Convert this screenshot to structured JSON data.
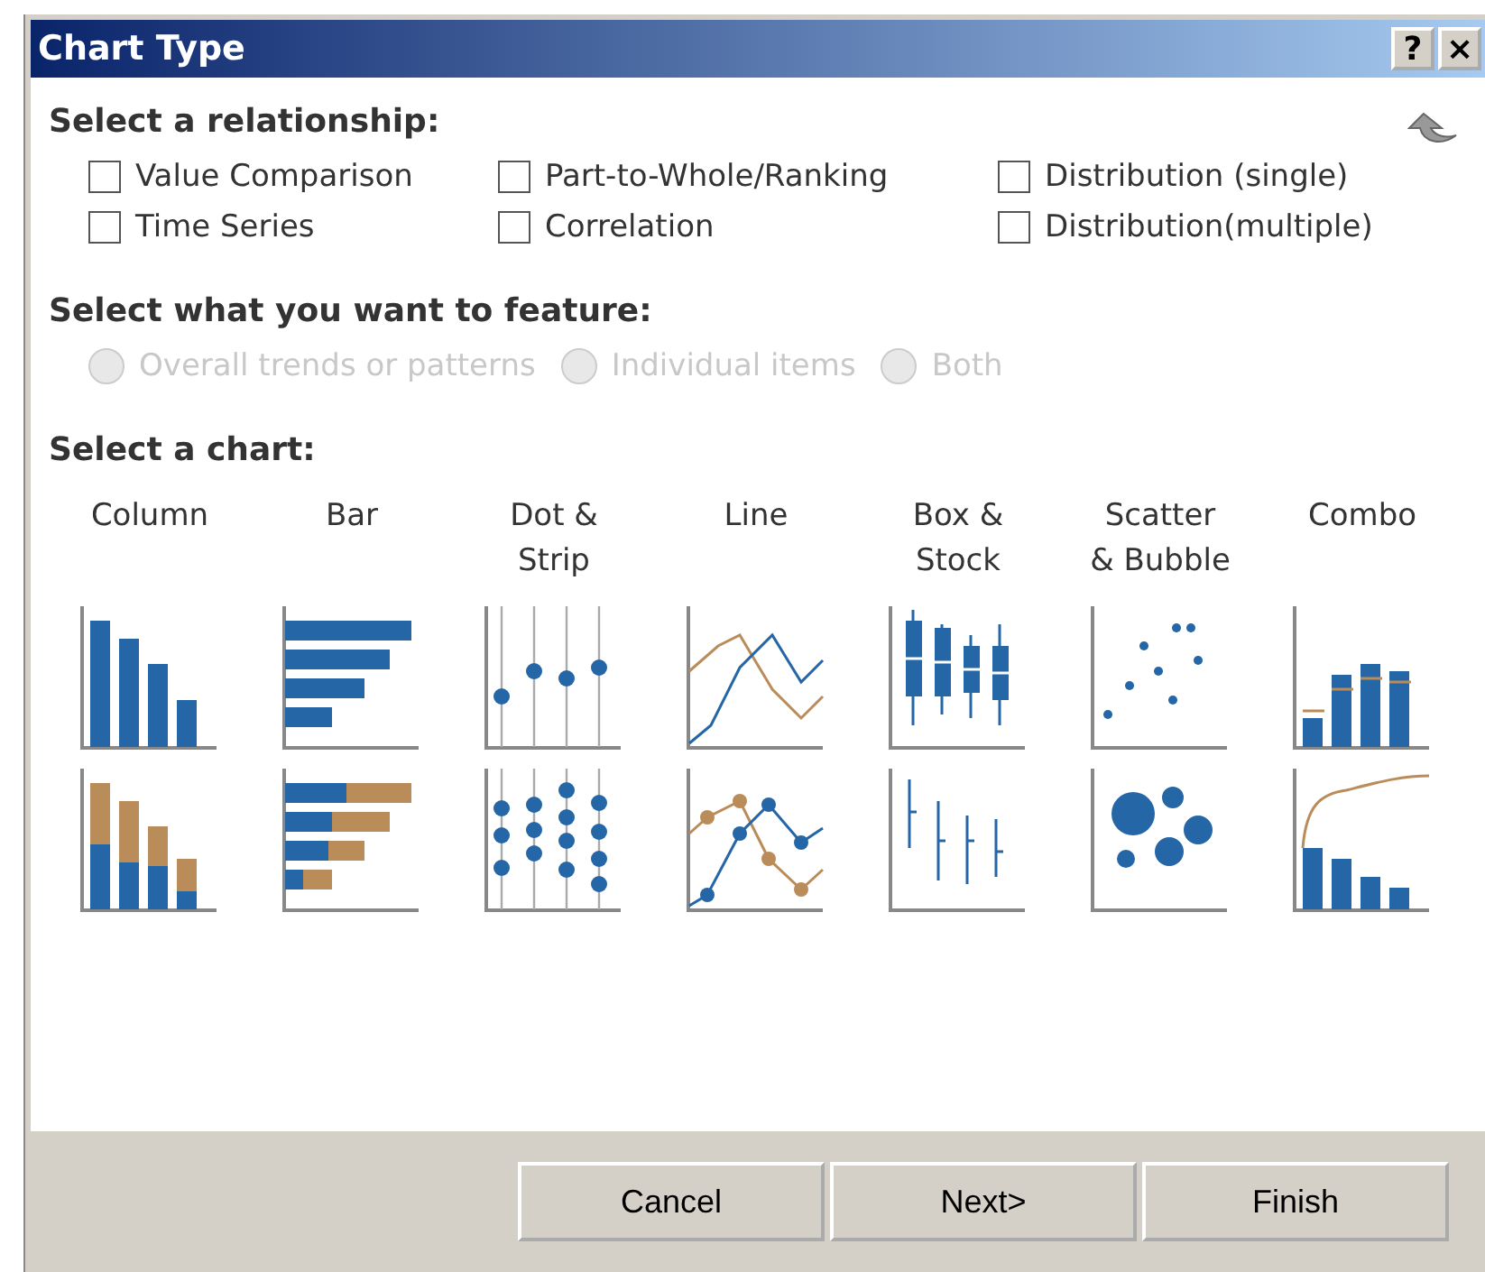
{
  "window": {
    "title": "Chart Type",
    "title_buttons": [
      "?",
      "×"
    ]
  },
  "relationship": {
    "heading": "Select a relationship:",
    "options": [
      {
        "label": "Value Comparison",
        "checked": false
      },
      {
        "label": "Part-to-Whole/Ranking",
        "checked": false
      },
      {
        "label": "Distribution (single)",
        "checked": false
      },
      {
        "label": "Time Series",
        "checked": false
      },
      {
        "label": "Correlation",
        "checked": false
      },
      {
        "label": "Distribution(multiple)",
        "checked": false
      }
    ]
  },
  "feature": {
    "heading": "Select what you want to feature:",
    "options": [
      {
        "label": "Overall trends or patterns",
        "selected": false,
        "disabled": true
      },
      {
        "label": "Individual items",
        "selected": false,
        "disabled": true
      },
      {
        "label": "Both",
        "selected": false,
        "disabled": true
      }
    ]
  },
  "charts": {
    "heading": "Select a chart:",
    "types": [
      {
        "label": "Column"
      },
      {
        "label": "Bar"
      },
      {
        "label": "Dot &\nStrip"
      },
      {
        "label": "Line"
      },
      {
        "label": "Box &\nStock"
      },
      {
        "label": "Scatter\n& Bubble"
      },
      {
        "label": "Combo"
      }
    ]
  },
  "buttons": [
    "Cancel",
    "Next>",
    "Finish"
  ]
}
